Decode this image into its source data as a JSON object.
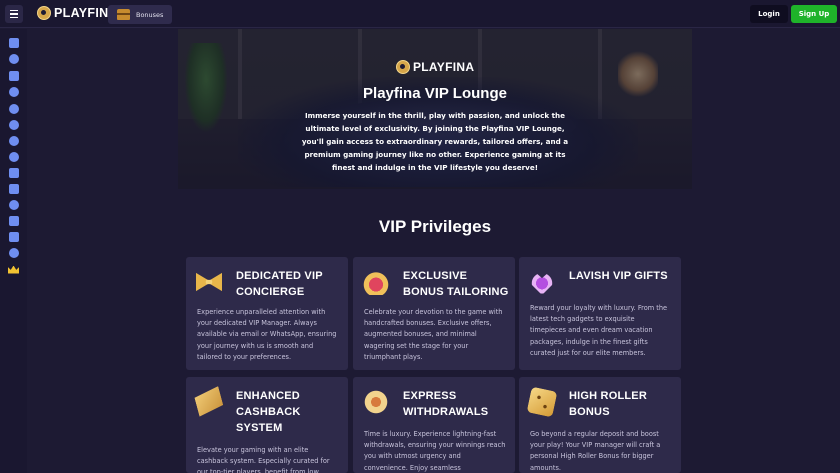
{
  "header": {
    "logo_text": "PLAYFINA",
    "bonus_label": "Bonuses",
    "login_label": "Login",
    "signup_label": "Sign Up"
  },
  "sidebar": {
    "icons": [
      "calendar-icon",
      "globe-icon",
      "megaphone-icon",
      "tag-icon",
      "refresh-icon",
      "star-icon",
      "badge-icon",
      "compass-icon",
      "cart-icon",
      "trophy-icon",
      "soccer-ball-icon",
      "ticket-icon",
      "gift-ticket-icon",
      "gear-icon",
      "crown-icon"
    ]
  },
  "hero": {
    "logo_text": "PLAYFINA",
    "title": "Playfina VIP Lounge",
    "text": "Immerse yourself in the thrill, play with passion, and unlock the ultimate level of exclusivity. By joining the Playfina VIP Lounge, you'll gain access to extraordinary rewards, tailored offers, and a premium gaming journey like no other. Experience gaming at its finest and indulge in the VIP lifestyle you deserve!"
  },
  "privileges": {
    "title": "VIP Privileges",
    "cards": [
      {
        "icon": "bow-tie-icon",
        "title": "DEDICATED VIP CONCIERGE",
        "text": "Experience unparalleled attention with your dedicated VIP Manager. Always available via email or WhatsApp, ensuring your journey with us is smooth and tailored to your preferences."
      },
      {
        "icon": "crown-icon",
        "title": "EXCLUSIVE BONUS TAILORING",
        "text": "Celebrate your devotion to the game with handcrafted bonuses. Exclusive offers, augmented bonuses, and minimal wagering set the stage for your triumphant plays."
      },
      {
        "icon": "gift-icon",
        "title": "LAVISH VIP GIFTS",
        "text": "Reward your loyalty with luxury. From the latest tech gadgets to exquisite timepieces and even dream vacation packages, indulge in the finest gifts curated just for our elite members."
      },
      {
        "icon": "cashback-icon",
        "title": "ENHANCED CASHBACK SYSTEM",
        "text": "Elevate your gaming with an elite cashback system. Especially curated for our top-tier players, benefit from low"
      },
      {
        "icon": "coin-icon",
        "title": "EXPRESS WITHDRAWALS",
        "text": "Time is luxury. Experience lightning-fast withdrawals, ensuring your winnings reach you with utmost urgency and convenience. Enjoy seamless"
      },
      {
        "icon": "dice-icon",
        "title": "HIGH ROLLER BONUS",
        "text": "Go beyond a regular deposit and boost your play! Your VIP manager will craft a personal High Roller Bonus for bigger amounts."
      }
    ]
  }
}
